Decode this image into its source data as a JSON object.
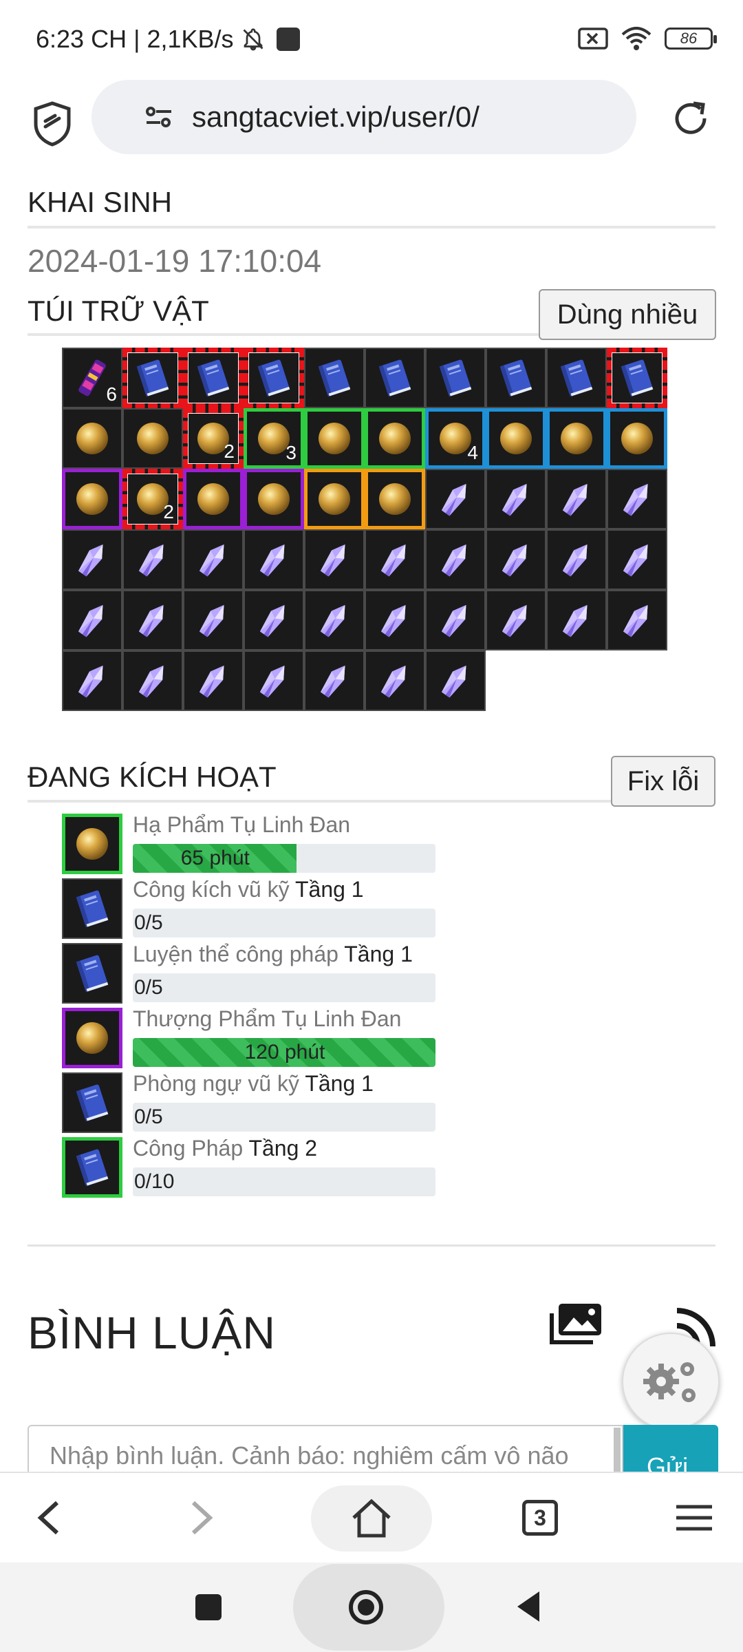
{
  "status_bar": {
    "time": "6:23 CH",
    "speed": "2,1KB/s",
    "battery": "86"
  },
  "browser": {
    "url": "sangtacviet.vip/user/0/",
    "tabs_count": "3"
  },
  "profile": {
    "birth_label": "KHAI SINH",
    "birth_date": "2024-01-19 17:10:04",
    "bag_label": "TÚI TRỮ VẬT",
    "use_many_button": "Dùng nhiều",
    "active_label": "ĐANG KÍCH HOẠT",
    "fix_button": "Fix lỗi"
  },
  "inventory": [
    {
      "item": "scroll-icon",
      "border": "none",
      "count": "6"
    },
    {
      "item": "book-icon",
      "border": "red",
      "count": ""
    },
    {
      "item": "book-icon",
      "border": "red",
      "count": ""
    },
    {
      "item": "book-icon",
      "border": "red",
      "count": ""
    },
    {
      "item": "book-icon",
      "border": "none",
      "count": ""
    },
    {
      "item": "book-icon",
      "border": "none",
      "count": ""
    },
    {
      "item": "book-icon",
      "border": "none",
      "count": ""
    },
    {
      "item": "book-icon",
      "border": "none",
      "count": ""
    },
    {
      "item": "book-icon",
      "border": "none",
      "count": ""
    },
    {
      "item": "book-icon",
      "border": "red",
      "count": ""
    },
    {
      "item": "pill-icon",
      "border": "none",
      "count": ""
    },
    {
      "item": "pill-icon",
      "border": "none",
      "count": ""
    },
    {
      "item": "pill-icon",
      "border": "red",
      "count": "2"
    },
    {
      "item": "pill-icon",
      "border": "green",
      "count": "3"
    },
    {
      "item": "pill-icon",
      "border": "green",
      "count": ""
    },
    {
      "item": "pill-icon",
      "border": "green",
      "count": ""
    },
    {
      "item": "pill-icon",
      "border": "blue",
      "count": "4"
    },
    {
      "item": "pill-icon",
      "border": "blue",
      "count": ""
    },
    {
      "item": "pill-icon",
      "border": "blue",
      "count": ""
    },
    {
      "item": "pill-icon",
      "border": "blue",
      "count": ""
    },
    {
      "item": "pill-icon",
      "border": "purple",
      "count": ""
    },
    {
      "item": "pill-icon",
      "border": "red",
      "count": "2"
    },
    {
      "item": "pill-icon",
      "border": "purple",
      "count": ""
    },
    {
      "item": "pill-icon",
      "border": "purple",
      "count": ""
    },
    {
      "item": "pill-icon",
      "border": "orange",
      "count": ""
    },
    {
      "item": "pill-icon",
      "border": "orange",
      "count": ""
    },
    {
      "item": "crystal-icon",
      "border": "none",
      "count": ""
    },
    {
      "item": "crystal-icon",
      "border": "none",
      "count": ""
    },
    {
      "item": "crystal-icon",
      "border": "none",
      "count": ""
    },
    {
      "item": "crystal-icon",
      "border": "none",
      "count": ""
    },
    {
      "item": "crystal-icon",
      "border": "none",
      "count": ""
    },
    {
      "item": "crystal-icon",
      "border": "none",
      "count": ""
    },
    {
      "item": "crystal-icon",
      "border": "none",
      "count": ""
    },
    {
      "item": "crystal-icon",
      "border": "none",
      "count": ""
    },
    {
      "item": "crystal-icon",
      "border": "none",
      "count": ""
    },
    {
      "item": "crystal-icon",
      "border": "none",
      "count": ""
    },
    {
      "item": "crystal-icon",
      "border": "none",
      "count": ""
    },
    {
      "item": "crystal-icon",
      "border": "none",
      "count": ""
    },
    {
      "item": "crystal-icon",
      "border": "none",
      "count": ""
    },
    {
      "item": "crystal-icon",
      "border": "none",
      "count": ""
    },
    {
      "item": "crystal-icon",
      "border": "none",
      "count": ""
    },
    {
      "item": "crystal-icon",
      "border": "none",
      "count": ""
    },
    {
      "item": "crystal-icon",
      "border": "none",
      "count": ""
    },
    {
      "item": "crystal-icon",
      "border": "none",
      "count": ""
    },
    {
      "item": "crystal-icon",
      "border": "none",
      "count": ""
    },
    {
      "item": "crystal-icon",
      "border": "none",
      "count": ""
    },
    {
      "item": "crystal-icon",
      "border": "none",
      "count": ""
    },
    {
      "item": "crystal-icon",
      "border": "none",
      "count": ""
    },
    {
      "item": "crystal-icon",
      "border": "none",
      "count": ""
    },
    {
      "item": "crystal-icon",
      "border": "none",
      "count": ""
    },
    {
      "item": "crystal-icon",
      "border": "none",
      "count": ""
    },
    {
      "item": "crystal-icon",
      "border": "none",
      "count": ""
    },
    {
      "item": "crystal-icon",
      "border": "none",
      "count": ""
    },
    {
      "item": "crystal-icon",
      "border": "none",
      "count": ""
    },
    {
      "item": "crystal-icon",
      "border": "none",
      "count": ""
    },
    {
      "item": "crystal-icon",
      "border": "none",
      "count": ""
    },
    {
      "item": "crystal-icon",
      "border": "none",
      "count": ""
    }
  ],
  "active_items": [
    {
      "name": "Hạ Phẩm Tụ Linh Đan",
      "tier": "",
      "item": "pill-icon",
      "border": "green",
      "progress_text": "65 phút",
      "progress": 0.54
    },
    {
      "name": "Công kích vũ kỹ",
      "tier": "Tầng 1",
      "item": "book-icon",
      "border": "none",
      "progress_text": "0/5",
      "progress": 0
    },
    {
      "name": "Luyện thể công pháp",
      "tier": "Tầng 1",
      "item": "book-icon",
      "border": "none",
      "progress_text": "0/5",
      "progress": 0
    },
    {
      "name": "Thượng Phẩm Tụ Linh Đan",
      "tier": "",
      "item": "pill-icon",
      "border": "purple",
      "progress_text": "120 phút",
      "progress": 1.0
    },
    {
      "name": "Phòng ngự vũ kỹ",
      "tier": "Tầng 1",
      "item": "book-icon",
      "border": "none",
      "progress_text": "0/5",
      "progress": 0
    },
    {
      "name": "Công Pháp",
      "tier": "Tầng 2",
      "item": "book-icon",
      "border": "green",
      "progress_text": "0/10",
      "progress": 0
    }
  ],
  "comments": {
    "title": "BÌNH LUẬN",
    "input_placeholder": "Nhập bình luận. Cảnh báo: nghiêm cấm vô não",
    "send_label": "Gửi"
  },
  "colors": {
    "red": "#e8141a",
    "green": "#2ecc40",
    "blue": "#1e90d8",
    "purple": "#9b1fd6",
    "orange": "#f39c12",
    "send": "#17a2b8"
  }
}
